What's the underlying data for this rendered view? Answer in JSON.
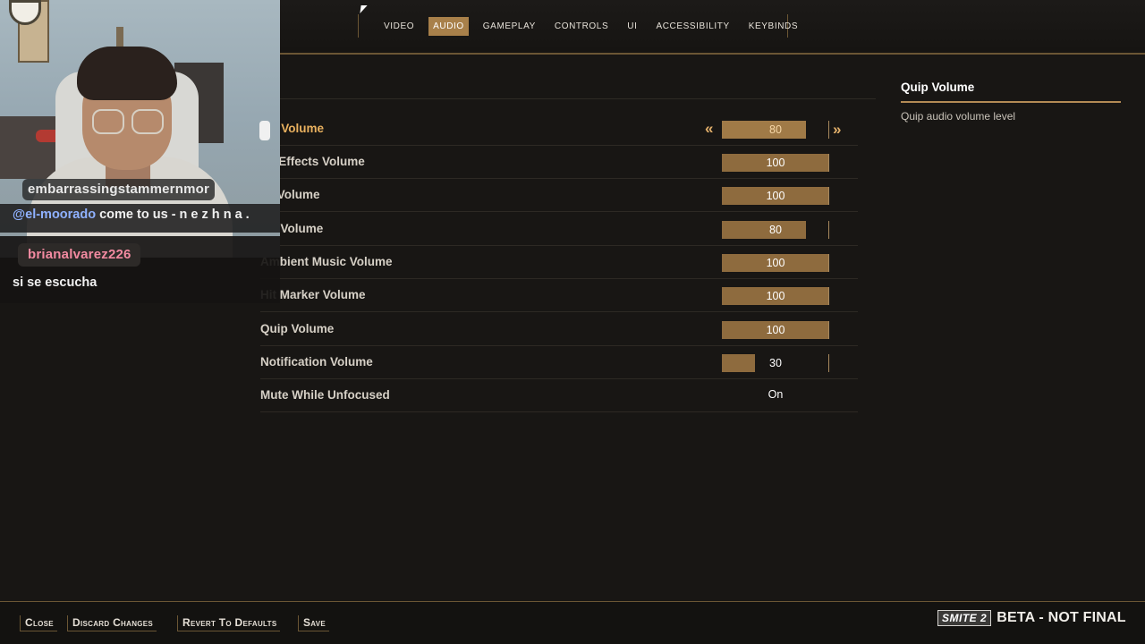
{
  "tabs": [
    {
      "label": "VIDEO",
      "active": false
    },
    {
      "label": "AUDIO",
      "active": true
    },
    {
      "label": "GAMEPLAY",
      "active": false
    },
    {
      "label": "CONTROLS",
      "active": false
    },
    {
      "label": "UI",
      "active": false
    },
    {
      "label": "ACCESSIBILITY",
      "active": false
    },
    {
      "label": "KEYBINDS",
      "active": false
    }
  ],
  "settings": [
    {
      "label": "bal Volume",
      "value": "80",
      "fill_fraction": 0.8
    },
    {
      "label": "nd Effects Volume",
      "value": "100",
      "fill_fraction": 1.0
    },
    {
      "label": "ce Volume",
      "value": "100",
      "fill_fraction": 1.0
    },
    {
      "label": "sic Volume",
      "value": "80",
      "fill_fraction": 0.8
    },
    {
      "label": "Ambient Music Volume",
      "value": "100",
      "fill_fraction": 1.0
    },
    {
      "label": "Hit Marker Volume",
      "value": "100",
      "fill_fraction": 1.0
    },
    {
      "label": "Quip Volume",
      "value": "100",
      "fill_fraction": 1.0
    },
    {
      "label": "Notification Volume",
      "value": "30",
      "fill_fraction": 0.3
    },
    {
      "label": "Mute While Unfocused",
      "value": "On"
    }
  ],
  "info_panel": {
    "title": "Quip Volume",
    "description": "Quip audio volume level"
  },
  "bottom_buttons": {
    "close": "Close",
    "discard": "Discard Changes",
    "revert": "Revert To Defaults",
    "save": "Save"
  },
  "brand": {
    "logo": "SMITE 2",
    "beta": "BETA - NOT FINAL"
  },
  "chat": {
    "user1": "embarrassingstammernmor",
    "msg1_mention": "@el-moorado",
    "msg1_text": " come to us - n e z h n a .",
    "user2": "brianalvarez226",
    "msg2": "si se escucha"
  },
  "colors": {
    "accent": "#a8804a",
    "highlight_text": "#e9b15f",
    "background": "#181614"
  }
}
